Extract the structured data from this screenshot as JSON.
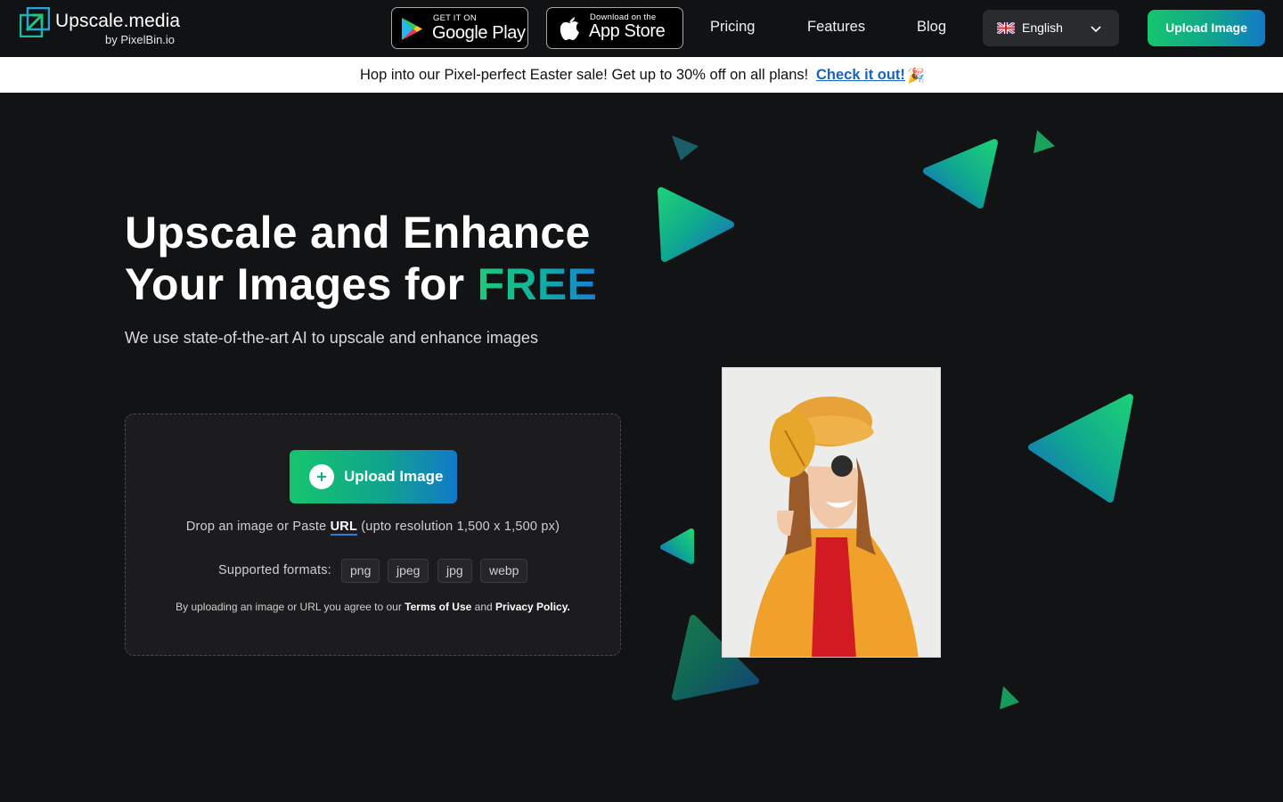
{
  "header": {
    "logo_title": "Upscale.media",
    "logo_sub": "by PixelBin.io",
    "google_play": {
      "small": "GET IT ON",
      "big": "Google Play"
    },
    "app_store": {
      "small": "Download on the",
      "big": "App Store"
    },
    "nav": [
      "Pricing",
      "Features",
      "Blog"
    ],
    "language": "English",
    "upload_label": "Upload Image"
  },
  "banner": {
    "text": "Hop into our Pixel-perfect Easter sale! Get up to 30% off on all plans!",
    "link": "Check it out!",
    "emoji": "🎉"
  },
  "hero": {
    "title_line1": "Upscale and Enhance",
    "title_line2_prefix": "Your Images for ",
    "title_highlight": "FREE",
    "subtitle": "We use state-of-the-art AI to upscale and enhance images"
  },
  "uploader": {
    "button_label": "Upload Image",
    "drop_prefix": "Drop an image or Paste ",
    "drop_url": "URL",
    "drop_suffix": " (upto resolution 1,500 x 1,500 px)",
    "formats_label": "Supported formats:",
    "formats": [
      "png",
      "jpeg",
      "jpg",
      "webp"
    ],
    "terms_prefix": "By uploading an image or URL you agree to our ",
    "terms_link": "Terms of Use",
    "terms_and": " and ",
    "privacy_link": "Privacy Policy."
  },
  "colors": {
    "accent_green": "#16c56e",
    "accent_blue": "#1279c9",
    "background": "#121315",
    "banner_link": "#1565c0"
  }
}
